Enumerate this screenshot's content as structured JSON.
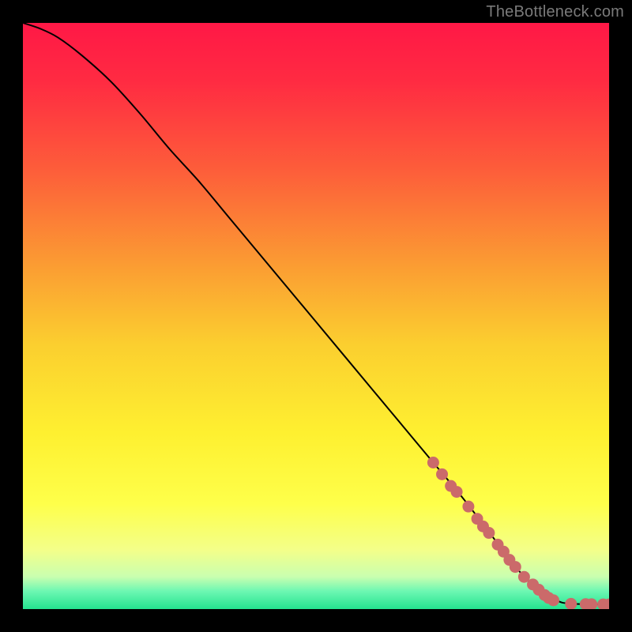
{
  "watermark": "TheBottleneck.com",
  "colors": {
    "frame": "#000000",
    "curve": "#000000",
    "dots": "#cb6a6a",
    "gradient_stops": [
      {
        "offset": 0.0,
        "color": "#ff1846"
      },
      {
        "offset": 0.1,
        "color": "#ff2b42"
      },
      {
        "offset": 0.25,
        "color": "#fd5d3a"
      },
      {
        "offset": 0.4,
        "color": "#fb9733"
      },
      {
        "offset": 0.55,
        "color": "#fbcf2f"
      },
      {
        "offset": 0.7,
        "color": "#fef030"
      },
      {
        "offset": 0.82,
        "color": "#feff4a"
      },
      {
        "offset": 0.9,
        "color": "#f3ff8a"
      },
      {
        "offset": 0.945,
        "color": "#c9ffb0"
      },
      {
        "offset": 0.97,
        "color": "#6bf7b2"
      },
      {
        "offset": 1.0,
        "color": "#24e38f"
      }
    ]
  },
  "chart_data": {
    "type": "line",
    "title": "",
    "xlabel": "",
    "ylabel": "",
    "xlim": [
      0,
      100
    ],
    "ylim": [
      0,
      100
    ],
    "grid": false,
    "legend": false,
    "series": [
      {
        "name": "bottleneck-curve",
        "x": [
          0,
          3,
          6,
          10,
          15,
          20,
          25,
          30,
          35,
          40,
          45,
          50,
          55,
          60,
          65,
          70,
          75,
          80,
          83,
          86,
          88.5,
          90.5,
          92,
          94,
          96,
          98,
          100
        ],
        "y": [
          100,
          99,
          97.5,
          94.5,
          90,
          84.5,
          78.5,
          73,
          67,
          61,
          55,
          49,
          43,
          37,
          31,
          25,
          19,
          12.5,
          8.5,
          5,
          3,
          1.8,
          1.1,
          0.9,
          0.85,
          0.8,
          0.8
        ]
      }
    ],
    "scatter": {
      "name": "highlighted-points",
      "x": [
        70,
        71.5,
        73,
        74,
        76,
        77.5,
        78.5,
        79.5,
        81,
        82,
        83,
        84,
        85.5,
        87,
        88,
        89,
        89.7,
        90.5,
        93.5,
        96,
        97,
        99,
        100
      ],
      "y": [
        25,
        23,
        21,
        20,
        17.5,
        15.4,
        14.1,
        13,
        11,
        9.8,
        8.4,
        7.2,
        5.5,
        4.2,
        3.3,
        2.4,
        1.9,
        1.5,
        0.9,
        0.85,
        0.82,
        0.8,
        0.8
      ]
    }
  }
}
